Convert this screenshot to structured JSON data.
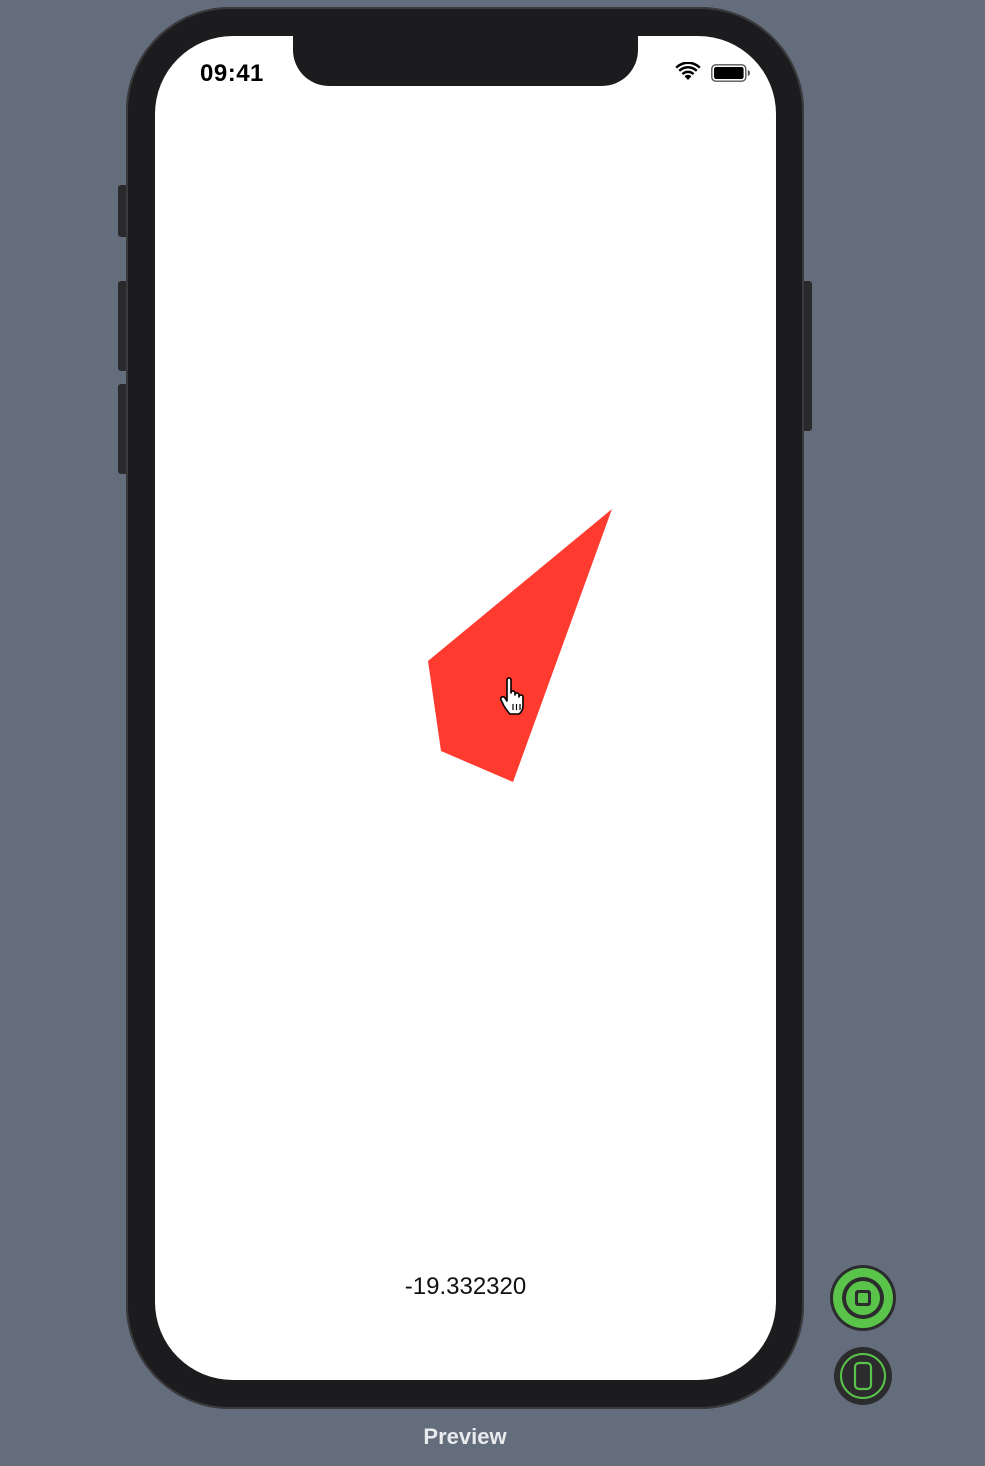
{
  "status_bar": {
    "time": "09:41",
    "icons": [
      "wifi-icon",
      "battery-icon"
    ]
  },
  "shape": {
    "fill_color": "#ff3b30"
  },
  "cursor": {
    "icon": "pointing-hand-cursor-icon"
  },
  "readout": {
    "value": "-19.332320"
  },
  "preview_controls": {
    "live_button_icon": "live-preview-icon",
    "live_button_color": "#5ac44a",
    "device_button_icon": "device-preview-icon",
    "label": "Preview"
  }
}
